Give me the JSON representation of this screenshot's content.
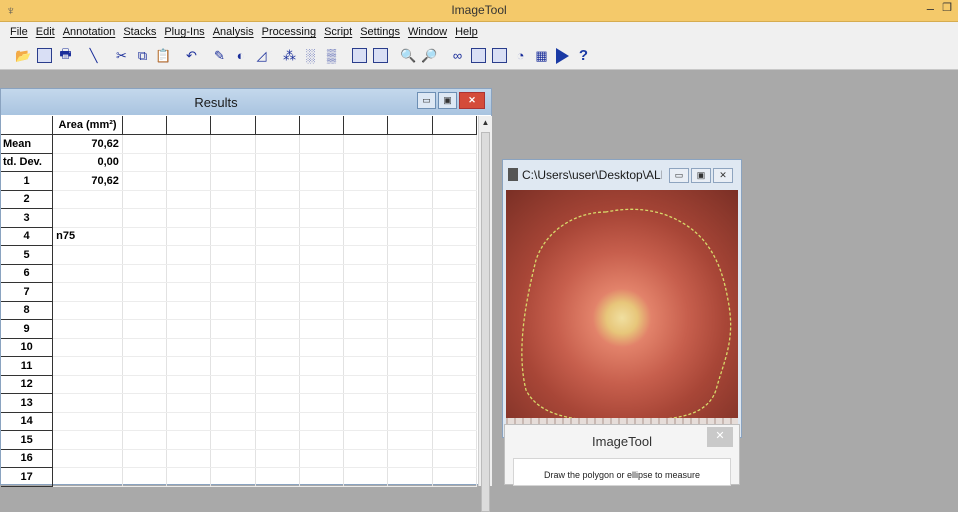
{
  "app": {
    "title": "ImageTool"
  },
  "menu": [
    "File",
    "Edit",
    "Annotation",
    "Stacks",
    "Plug-Ins",
    "Analysis",
    "Processing",
    "Script",
    "Settings",
    "Window",
    "Help"
  ],
  "results": {
    "title": "Results",
    "column_header": "Area (mm²)",
    "rows": [
      {
        "label": "Mean",
        "value": "70,62"
      },
      {
        "label": "td. Dev.",
        "value": "0,00"
      },
      {
        "label": "1",
        "value": "70,62"
      },
      {
        "label": "2",
        "value": ""
      },
      {
        "label": "3",
        "value": ""
      },
      {
        "label": "4",
        "value": "n75"
      },
      {
        "label": "5",
        "value": ""
      },
      {
        "label": "6",
        "value": ""
      },
      {
        "label": "7",
        "value": ""
      },
      {
        "label": "8",
        "value": ""
      },
      {
        "label": "9",
        "value": ""
      },
      {
        "label": "10",
        "value": ""
      },
      {
        "label": "11",
        "value": ""
      },
      {
        "label": "12",
        "value": ""
      },
      {
        "label": "13",
        "value": ""
      },
      {
        "label": "14",
        "value": ""
      },
      {
        "label": "15",
        "value": ""
      },
      {
        "label": "16",
        "value": ""
      },
      {
        "label": "17",
        "value": ""
      }
    ]
  },
  "image_window": {
    "title": "C:\\Users\\user\\Desktop\\ALE..."
  },
  "dialog": {
    "title": "ImageTool",
    "message": "Draw the polygon or ellipse to measure"
  },
  "colors": {
    "titlebar": "#f4c96a",
    "workspace": "#a9a9a9",
    "results_title": "#b8cfe7"
  }
}
